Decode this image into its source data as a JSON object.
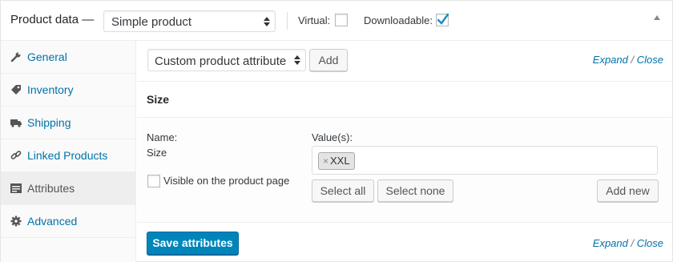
{
  "header": {
    "title": "Product data —",
    "product_type": "Simple product",
    "virtual_label": "Virtual:",
    "virtual_checked": false,
    "downloadable_label": "Downloadable:",
    "downloadable_checked": true
  },
  "sidebar": {
    "items": [
      {
        "label": "General",
        "icon": "wrench-icon"
      },
      {
        "label": "Inventory",
        "icon": "tag-icon"
      },
      {
        "label": "Shipping",
        "icon": "truck-icon"
      },
      {
        "label": "Linked Products",
        "icon": "link-icon"
      },
      {
        "label": "Attributes",
        "icon": "list-icon",
        "active": true
      },
      {
        "label": "Advanced",
        "icon": "gear-icon"
      }
    ]
  },
  "toolbar": {
    "attribute_select": "Custom product attribute",
    "add_label": "Add",
    "expand": "Expand",
    "slash": "/",
    "close": "Close"
  },
  "attribute": {
    "name": "Size",
    "name_label": "Name:",
    "name_value": "Size",
    "values_label": "Value(s):",
    "chip_remove": "×",
    "values": [
      "XXL"
    ],
    "visible_label": "Visible on the product page",
    "visible_checked": false,
    "select_all": "Select all",
    "select_none": "Select none",
    "add_new": "Add new"
  },
  "footer": {
    "save_label": "Save attributes",
    "expand": "Expand",
    "slash": "/",
    "close": "Close"
  },
  "colors": {
    "link": "#0073aa",
    "primary": "#0085ba"
  }
}
